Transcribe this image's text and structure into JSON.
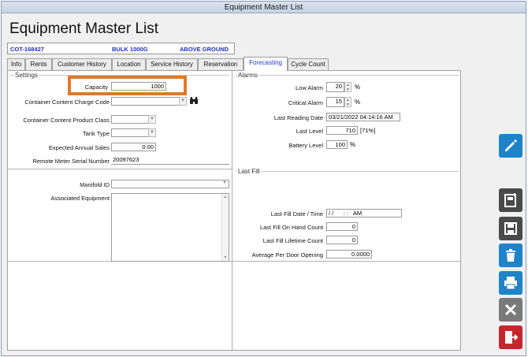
{
  "window": {
    "title": "Equipment Master List"
  },
  "header": {
    "title": "Equipment Master List",
    "equipment_id": "COT-168427",
    "description": "BULK 1000G",
    "location_type": "ABOVE GROUND"
  },
  "tabs": [
    {
      "label": "Info"
    },
    {
      "label": "Rents"
    },
    {
      "label": "Customer History"
    },
    {
      "label": "Location"
    },
    {
      "label": "Service History"
    },
    {
      "label": "Reservation"
    },
    {
      "label": "Forecasting"
    },
    {
      "label": "Cycle Count"
    }
  ],
  "active_tab": "Forecasting",
  "settings": {
    "group_label": "Settings",
    "capacity_label": "Capacity",
    "capacity_value": "1000",
    "charge_code_label": "Container Content Charge Code",
    "charge_code_value": "",
    "product_class_label": "Container Content Product Class",
    "product_class_value": "",
    "tank_type_label": "Tank Type",
    "tank_type_value": "",
    "annual_sales_label": "Expected Annual Sales",
    "annual_sales_value": "0.00",
    "meter_serial_label": "Remote Meter Serial Number",
    "meter_serial_value": "20097623"
  },
  "manifold": {
    "manifold_label": "Manifold ID",
    "manifold_value": "",
    "associated_label": "Associated Equipment"
  },
  "alarms": {
    "group_label": "Alarms",
    "low_alarm_label": "Low Alarm",
    "low_alarm_value": "20",
    "critical_alarm_label": "Critical Alarm",
    "critical_alarm_value": "15",
    "percent_unit": "%",
    "last_reading_label": "Last Reading Date",
    "last_reading_value": "03/21/2022 04:14:16 AM",
    "last_level_label": "Last Level",
    "last_level_value": "710",
    "last_level_pct": "[71%]",
    "battery_label": "Battery Level",
    "battery_value": "100"
  },
  "last_fill": {
    "group_label": "Last Fill",
    "date_label": "Last Fill Date / Time",
    "date_value": "/ /      : :   AM",
    "on_hand_label": "Last Fill On Hand Count",
    "on_hand_value": "0",
    "lifetime_label": "Last Fill Lifetime Count",
    "lifetime_value": "0",
    "per_door_label": "Average Per Door Opening",
    "per_door_value": "0.0000"
  },
  "colors": {
    "highlight": "#e07a2a",
    "blue_button": "#1f84c7",
    "dark_button": "#4a4a4a",
    "grey_button": "#7a7a7a",
    "red_button": "#c4262e",
    "active_tab_text": "#1f3bd8"
  },
  "icons": {
    "edit": "pencil-icon",
    "new": "new-document-icon",
    "save": "floppy-disk-icon",
    "delete": "trash-icon",
    "print": "printer-icon",
    "cancel": "x-icon",
    "exit": "exit-door-icon",
    "lookup": "binoculars-icon"
  }
}
